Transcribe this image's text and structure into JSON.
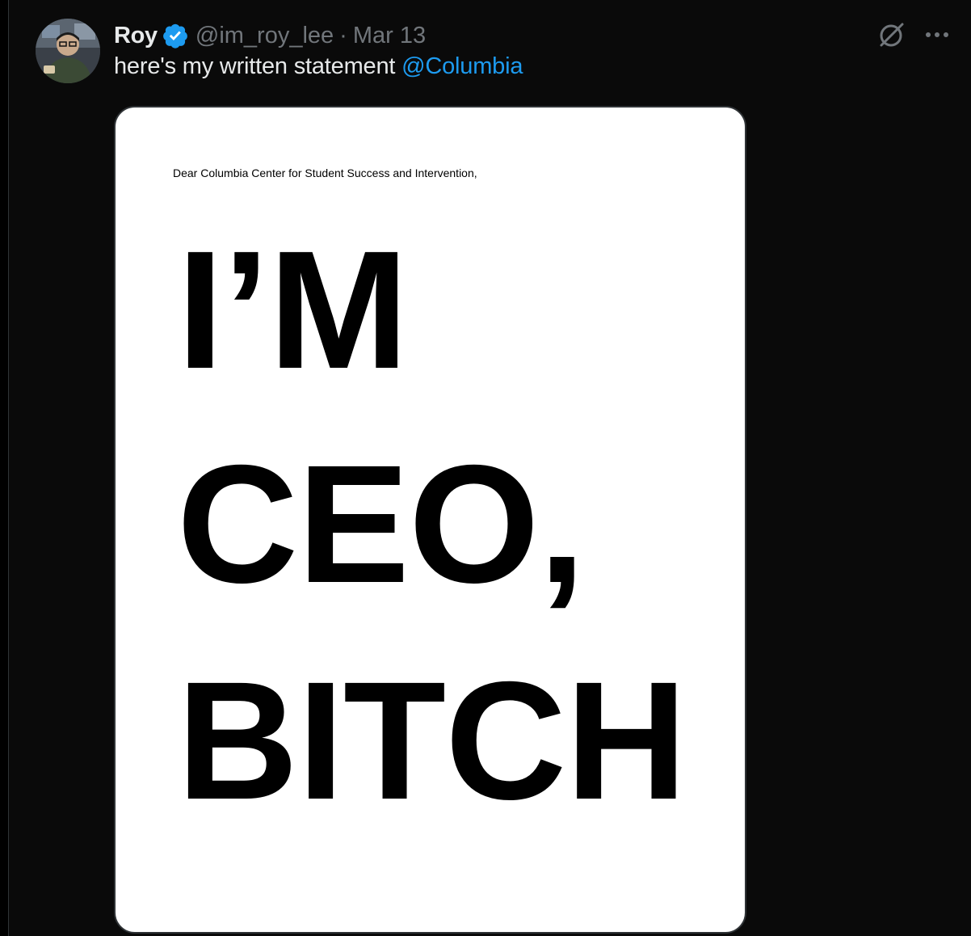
{
  "tweet": {
    "display_name": "Roy",
    "verified_icon": "verified-badge-icon",
    "handle": "@im_roy_lee",
    "separator": "·",
    "date": "Mar 13",
    "text": "here's my written statement ",
    "mention": "@Columbia"
  },
  "media": {
    "greeting": "Dear Columbia Center for Student Success and Intervention,",
    "line1": "I’M",
    "line2": "CEO,",
    "line3": "BITCH"
  },
  "icons": {
    "grok": "grok-icon",
    "more": "more-icon"
  },
  "colors": {
    "background": "#000000",
    "text_primary": "#e7e9ea",
    "text_secondary": "#71767b",
    "accent": "#1d9bf0"
  }
}
